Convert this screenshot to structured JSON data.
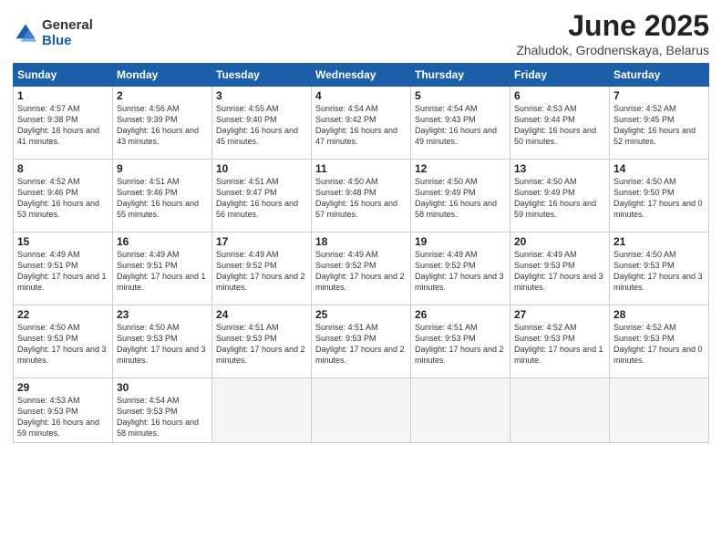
{
  "logo": {
    "general": "General",
    "blue": "Blue"
  },
  "header": {
    "month": "June 2025",
    "location": "Zhaludok, Grodnenskaya, Belarus"
  },
  "days_of_week": [
    "Sunday",
    "Monday",
    "Tuesday",
    "Wednesday",
    "Thursday",
    "Friday",
    "Saturday"
  ],
  "days": [
    {
      "num": "1",
      "sunrise": "4:57 AM",
      "sunset": "9:38 PM",
      "daylight": "16 hours and 41 minutes."
    },
    {
      "num": "2",
      "sunrise": "4:56 AM",
      "sunset": "9:39 PM",
      "daylight": "16 hours and 43 minutes."
    },
    {
      "num": "3",
      "sunrise": "4:55 AM",
      "sunset": "9:40 PM",
      "daylight": "16 hours and 45 minutes."
    },
    {
      "num": "4",
      "sunrise": "4:54 AM",
      "sunset": "9:42 PM",
      "daylight": "16 hours and 47 minutes."
    },
    {
      "num": "5",
      "sunrise": "4:54 AM",
      "sunset": "9:43 PM",
      "daylight": "16 hours and 49 minutes."
    },
    {
      "num": "6",
      "sunrise": "4:53 AM",
      "sunset": "9:44 PM",
      "daylight": "16 hours and 50 minutes."
    },
    {
      "num": "7",
      "sunrise": "4:52 AM",
      "sunset": "9:45 PM",
      "daylight": "16 hours and 52 minutes."
    },
    {
      "num": "8",
      "sunrise": "4:52 AM",
      "sunset": "9:46 PM",
      "daylight": "16 hours and 53 minutes."
    },
    {
      "num": "9",
      "sunrise": "4:51 AM",
      "sunset": "9:46 PM",
      "daylight": "16 hours and 55 minutes."
    },
    {
      "num": "10",
      "sunrise": "4:51 AM",
      "sunset": "9:47 PM",
      "daylight": "16 hours and 56 minutes."
    },
    {
      "num": "11",
      "sunrise": "4:50 AM",
      "sunset": "9:48 PM",
      "daylight": "16 hours and 57 minutes."
    },
    {
      "num": "12",
      "sunrise": "4:50 AM",
      "sunset": "9:49 PM",
      "daylight": "16 hours and 58 minutes."
    },
    {
      "num": "13",
      "sunrise": "4:50 AM",
      "sunset": "9:49 PM",
      "daylight": "16 hours and 59 minutes."
    },
    {
      "num": "14",
      "sunrise": "4:50 AM",
      "sunset": "9:50 PM",
      "daylight": "17 hours and 0 minutes."
    },
    {
      "num": "15",
      "sunrise": "4:49 AM",
      "sunset": "9:51 PM",
      "daylight": "17 hours and 1 minute."
    },
    {
      "num": "16",
      "sunrise": "4:49 AM",
      "sunset": "9:51 PM",
      "daylight": "17 hours and 1 minute."
    },
    {
      "num": "17",
      "sunrise": "4:49 AM",
      "sunset": "9:52 PM",
      "daylight": "17 hours and 2 minutes."
    },
    {
      "num": "18",
      "sunrise": "4:49 AM",
      "sunset": "9:52 PM",
      "daylight": "17 hours and 2 minutes."
    },
    {
      "num": "19",
      "sunrise": "4:49 AM",
      "sunset": "9:52 PM",
      "daylight": "17 hours and 3 minutes."
    },
    {
      "num": "20",
      "sunrise": "4:49 AM",
      "sunset": "9:53 PM",
      "daylight": "17 hours and 3 minutes."
    },
    {
      "num": "21",
      "sunrise": "4:50 AM",
      "sunset": "9:53 PM",
      "daylight": "17 hours and 3 minutes."
    },
    {
      "num": "22",
      "sunrise": "4:50 AM",
      "sunset": "9:53 PM",
      "daylight": "17 hours and 3 minutes."
    },
    {
      "num": "23",
      "sunrise": "4:50 AM",
      "sunset": "9:53 PM",
      "daylight": "17 hours and 3 minutes."
    },
    {
      "num": "24",
      "sunrise": "4:51 AM",
      "sunset": "9:53 PM",
      "daylight": "17 hours and 2 minutes."
    },
    {
      "num": "25",
      "sunrise": "4:51 AM",
      "sunset": "9:53 PM",
      "daylight": "17 hours and 2 minutes."
    },
    {
      "num": "26",
      "sunrise": "4:51 AM",
      "sunset": "9:53 PM",
      "daylight": "17 hours and 2 minutes."
    },
    {
      "num": "27",
      "sunrise": "4:52 AM",
      "sunset": "9:53 PM",
      "daylight": "17 hours and 1 minute."
    },
    {
      "num": "28",
      "sunrise": "4:52 AM",
      "sunset": "9:53 PM",
      "daylight": "17 hours and 0 minutes."
    },
    {
      "num": "29",
      "sunrise": "4:53 AM",
      "sunset": "9:53 PM",
      "daylight": "16 hours and 59 minutes."
    },
    {
      "num": "30",
      "sunrise": "4:54 AM",
      "sunset": "9:53 PM",
      "daylight": "16 hours and 58 minutes."
    }
  ]
}
